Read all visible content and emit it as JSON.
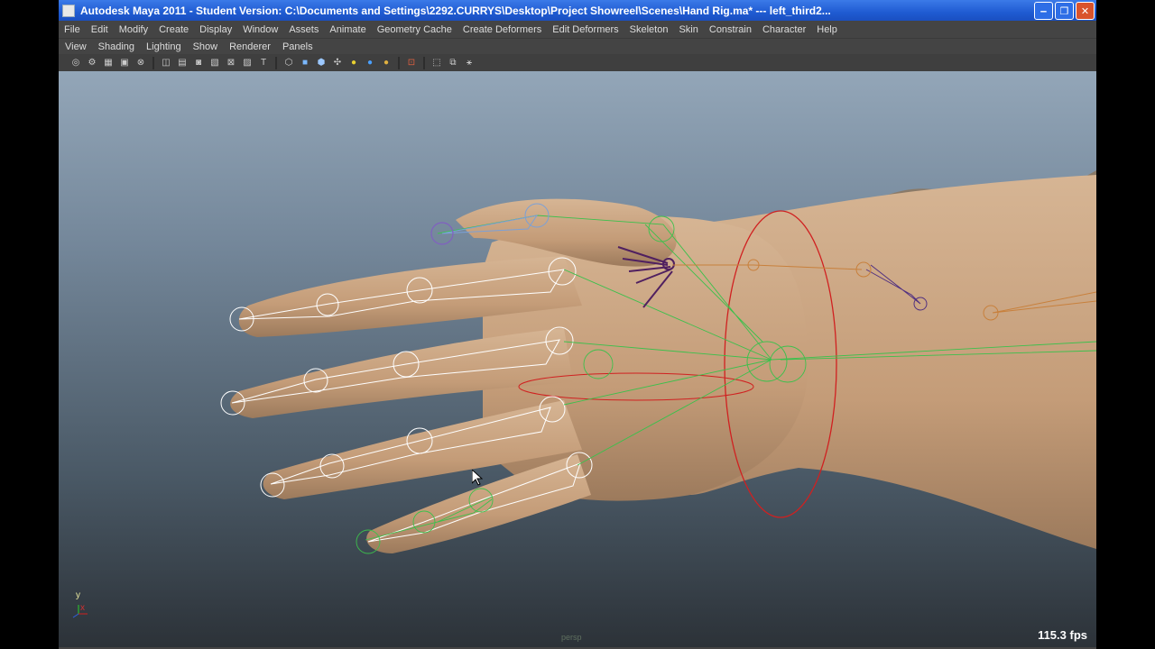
{
  "window": {
    "title": "Autodesk Maya 2011 - Student Version: C:\\Documents and Settings\\2292.CURRYS\\Desktop\\Project Showreel\\Scenes\\Hand Rig.ma*   ---   left_third2...",
    "minimize": "‒",
    "maximize": "❐",
    "close": "✕"
  },
  "menubar": [
    "File",
    "Edit",
    "Modify",
    "Create",
    "Display",
    "Window",
    "Assets",
    "Animate",
    "Geometry Cache",
    "Create Deformers",
    "Edit Deformers",
    "Skeleton",
    "Skin",
    "Constrain",
    "Character",
    "Help"
  ],
  "panel_menu": [
    "View",
    "Shading",
    "Lighting",
    "Show",
    "Renderer",
    "Panels"
  ],
  "toolbar_icons": [
    "camera-select-icon",
    "camera-attributes-icon",
    "bookmark-icon",
    "image-plane-icon",
    "grid-icon",
    "wireframe-icon",
    "smooth-shade-icon",
    "textured-icon",
    "lights-icon",
    "shadows-icon",
    "xray-icon",
    "isolate-icon",
    "resolution-gate-icon",
    "film-gate-icon",
    "field-chart-icon",
    "safe-action-icon",
    "safe-title-icon"
  ],
  "viewport": {
    "fps": "115.3 fps",
    "camera": "persp",
    "axis_y": "y",
    "axis_x": "x"
  }
}
